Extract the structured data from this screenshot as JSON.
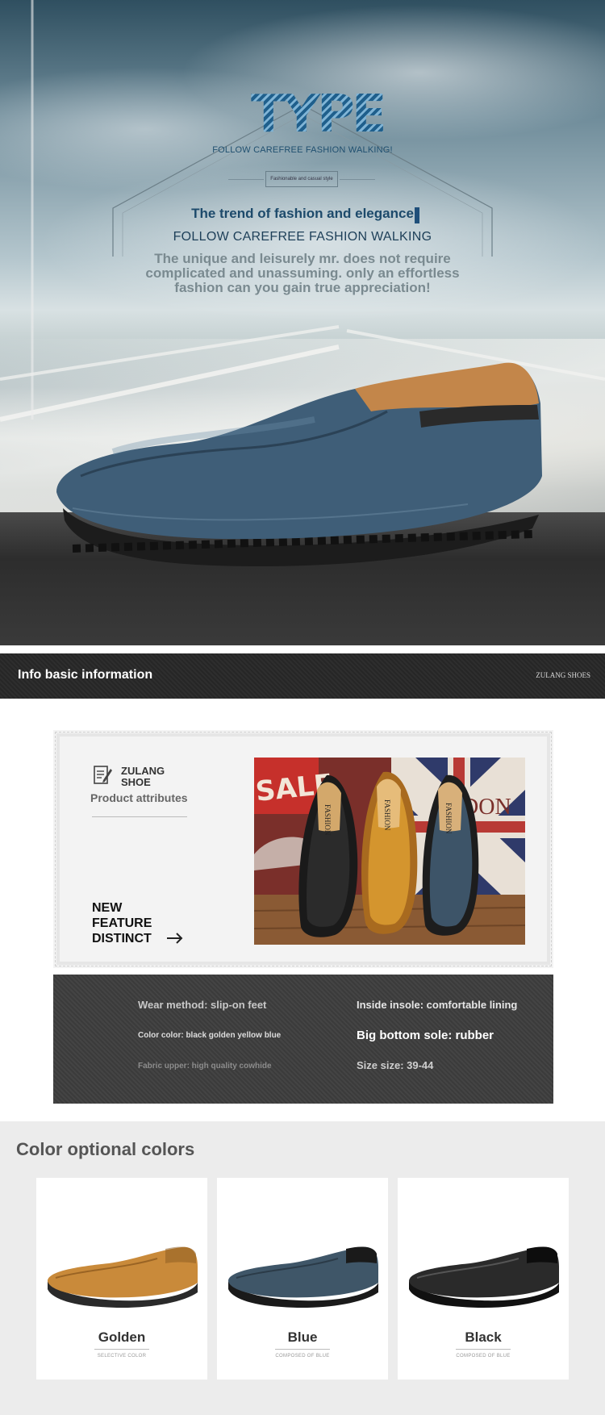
{
  "hero": {
    "logo": "TYPE",
    "logo_sub": "FOLLOW CAREFREE FASHION WALKING!",
    "tag": "Fashionable and casual style",
    "trend": "The trend of fashion and elegance",
    "follow": "FOLLOW CAREFREE FASHION WALKING",
    "desc_lines": [
      "The unique and leisurely mr. does not require",
      "complicated and unassuming. only an effortless",
      "fashion can you gain true appreciation!"
    ],
    "shoe_color": "#3f5e78"
  },
  "info": {
    "title": "Info basic information",
    "brand": "ZULANG SHOES"
  },
  "attributes": {
    "brand_line1": "ZULANG",
    "brand_line2": "SHOE",
    "subtitle": "Product attributes",
    "feature_lines": [
      "NEW",
      "FEATURE",
      "DISTINCT"
    ],
    "photo": {
      "sign_text": "SALE",
      "bg_text": "DON",
      "shoe_labels": [
        "FASHION",
        "FASHION",
        "FASHION"
      ],
      "shoe_colors": [
        "#2b2b2b",
        "#d4952e",
        "#3d5468"
      ]
    }
  },
  "specs": {
    "wear": "Wear method: slip-on feet",
    "insole": "Inside insole: comfortable lining",
    "color": "Color color: black golden yellow blue",
    "sole": "Big bottom sole: rubber",
    "fabric": "Fabric upper: high quality cowhide",
    "size": "Size size: 39-44"
  },
  "colors": {
    "title": "Color optional colors",
    "items": [
      {
        "name": "Golden",
        "caption": "SELECTIVE COLOR",
        "color": "#c98a3a"
      },
      {
        "name": "Blue",
        "caption": "COMPOSED OF BLUE",
        "color": "#3f5668"
      },
      {
        "name": "Black",
        "caption": "COMPOSED OF BLUE",
        "color": "#2a2a2a"
      }
    ]
  }
}
